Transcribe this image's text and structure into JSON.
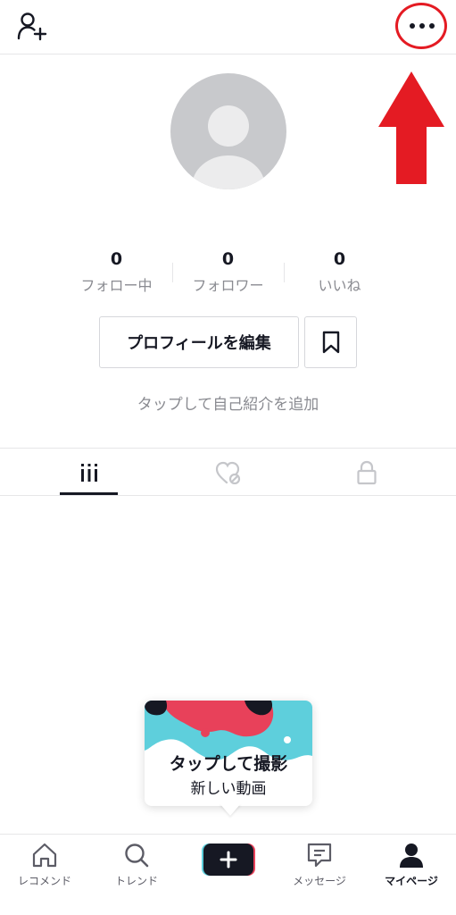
{
  "header": {
    "add_user_icon": "person-add-icon",
    "more_icon": "more-horizontal-icon",
    "annotation_color": "#e41b23"
  },
  "profile": {
    "stats": [
      {
        "value": "0",
        "label": "フォロー中"
      },
      {
        "value": "0",
        "label": "フォロワー"
      },
      {
        "value": "0",
        "label": "いいね"
      }
    ],
    "edit_button_label": "プロフィールを編集",
    "bio_placeholder": "タップして自己紹介を追加"
  },
  "tabs": [
    {
      "icon": "grid-icon",
      "active": true
    },
    {
      "icon": "liked-heart-icon",
      "active": false
    },
    {
      "icon": "lock-icon",
      "active": false
    }
  ],
  "tooltip": {
    "title": "タップして撮影",
    "subtitle": "新しい動画"
  },
  "nav": {
    "items": [
      {
        "label": "レコメンド",
        "icon": "home-icon"
      },
      {
        "label": "トレンド",
        "icon": "search-icon"
      },
      {
        "label": "",
        "icon": "plus-icon"
      },
      {
        "label": "メッセージ",
        "icon": "message-icon"
      },
      {
        "label": "マイページ",
        "icon": "profile-icon",
        "active": true
      }
    ]
  },
  "colors": {
    "text": "#161823",
    "muted": "#8a8b91",
    "border": "#e6e6e8",
    "tiktok_cyan": "#5ecfdc",
    "tiktok_red": "#e8415a"
  }
}
